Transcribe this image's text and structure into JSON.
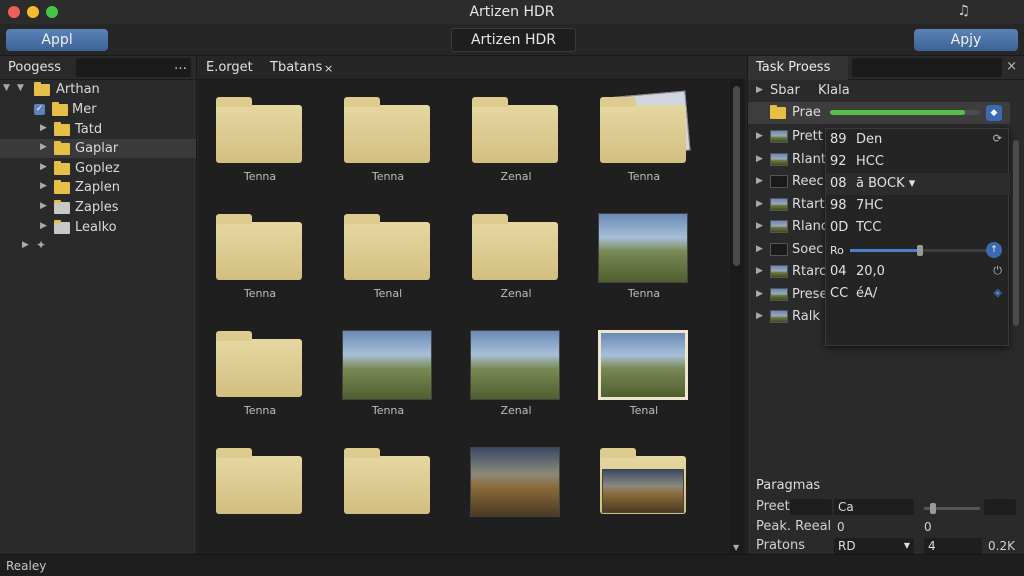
{
  "window": {
    "title": "Artizen HDR",
    "corner_icon": "music-note-icon"
  },
  "toolbar": {
    "left_button": "Appl",
    "center_title": "Artizen HDR",
    "right_button": "Apjy"
  },
  "left_panel": {
    "title": "Poogess",
    "menu": "…",
    "tree": [
      {
        "label": "Arthan",
        "expanded": true
      },
      {
        "label": "Mer",
        "checked": true
      },
      {
        "label": "Tatd"
      },
      {
        "label": "Gaplar",
        "selected": true
      },
      {
        "label": "Goplez"
      },
      {
        "label": "Zaplen"
      },
      {
        "label": "Zaples"
      },
      {
        "label": "Lealko"
      }
    ]
  },
  "center_panel": {
    "tabs": [
      "E.orget",
      "Tbatans"
    ],
    "tab_close": "×",
    "grid": [
      {
        "kind": "folder",
        "label": "Tenna"
      },
      {
        "kind": "folder",
        "label": "Tenna"
      },
      {
        "kind": "folder",
        "label": "Zenal"
      },
      {
        "kind": "folder-stack",
        "label": "Tenna"
      },
      {
        "kind": "folder",
        "label": "Tenna"
      },
      {
        "kind": "folder",
        "label": "Tenal"
      },
      {
        "kind": "folder",
        "label": "Zenal"
      },
      {
        "kind": "photo",
        "label": "Tenna"
      },
      {
        "kind": "folder",
        "label": "Tenna"
      },
      {
        "kind": "photo",
        "label": "Tenna"
      },
      {
        "kind": "photo",
        "label": "Zenal"
      },
      {
        "kind": "photo-frame",
        "label": "Tenal"
      },
      {
        "kind": "folder",
        "label": ""
      },
      {
        "kind": "folder",
        "label": ""
      },
      {
        "kind": "photo-dusk",
        "label": ""
      },
      {
        "kind": "folder-photo",
        "label": ""
      }
    ]
  },
  "task_panel": {
    "title": "Task Proess",
    "close": "×",
    "group": {
      "label": "Sbar",
      "extra": "Klala"
    },
    "preset_row": {
      "label": "Prae",
      "progress": 0.9
    },
    "tasks": [
      {
        "label": "Prett"
      },
      {
        "label": "Rlant"
      },
      {
        "label": "Reec"
      },
      {
        "label": "Rtart"
      },
      {
        "label": "Rlanc"
      },
      {
        "label": "Soec"
      },
      {
        "label": "Rtarc"
      },
      {
        "label": "Prese"
      },
      {
        "label": "Ralk"
      }
    ],
    "popover": [
      {
        "code": "89",
        "text": "Den",
        "right": "refresh-icon"
      },
      {
        "code": "92",
        "text": "HCC"
      },
      {
        "code": "08",
        "text": "ā BOCK ▾"
      },
      {
        "code": "98",
        "text": "7HC"
      },
      {
        "code": "0D",
        "text": "TCC"
      },
      {
        "code": "Ro",
        "slider": 0.5
      },
      {
        "code": "04",
        "text": "20,0",
        "right": "power-icon"
      },
      {
        "code": "CC",
        "text": "éA/",
        "right": "diamond-icon"
      }
    ]
  },
  "parameters": {
    "title": "Paragmas",
    "rows": [
      {
        "label": "Preet",
        "value": "",
        "mid": "Ca"
      },
      {
        "label": "Peak. Reeal",
        "value": "0",
        "mid": "0"
      },
      {
        "label": "Pratons",
        "value": "RD",
        "mid": "4",
        "right": "0.2K"
      }
    ]
  },
  "status": {
    "text": "Realey"
  },
  "colors": {
    "accent": "#4d80c6",
    "progress": "#56c24a",
    "folder": "#e7bf47"
  }
}
